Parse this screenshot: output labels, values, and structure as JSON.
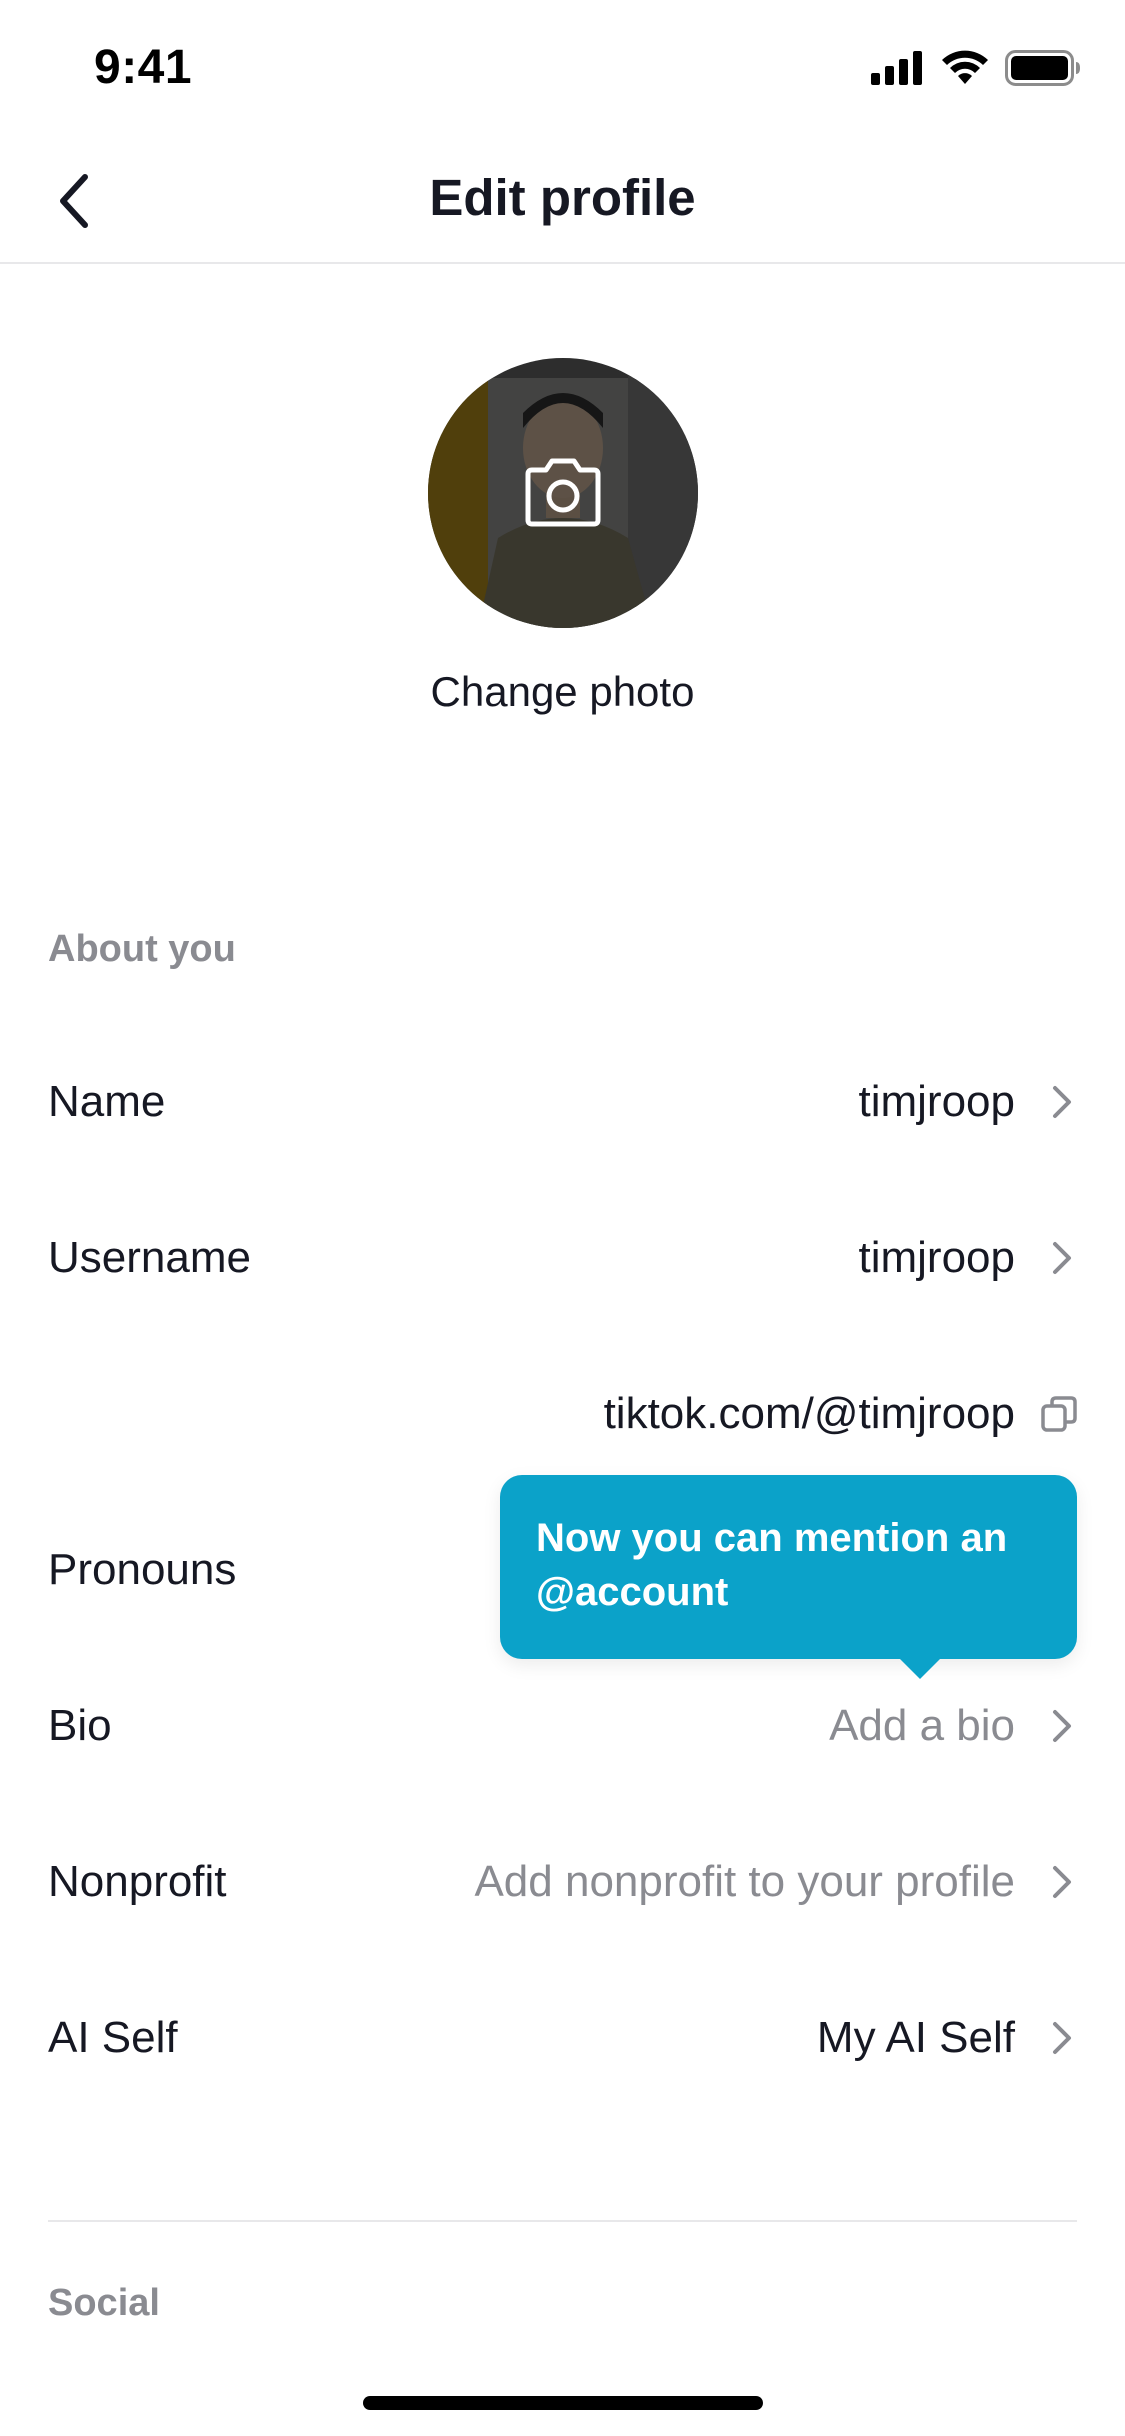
{
  "status_bar": {
    "time": "9:41"
  },
  "header": {
    "title": "Edit profile"
  },
  "avatar": {
    "change_photo_label": "Change photo"
  },
  "about_you": {
    "section_label": "About you",
    "rows": {
      "name": {
        "label": "Name",
        "value": "timjroop"
      },
      "username": {
        "label": "Username",
        "value": "timjroop"
      },
      "profile_url": "tiktok.com/@timjroop",
      "pronouns": {
        "label": "Pronouns",
        "value": ""
      },
      "bio": {
        "label": "Bio",
        "placeholder": "Add a bio"
      },
      "nonprofit": {
        "label": "Nonprofit",
        "placeholder": "Add nonprofit to your profile"
      },
      "ai_self": {
        "label": "AI Self",
        "value": "My AI Self"
      }
    }
  },
  "tooltip": {
    "text": "Now you can mention an @account"
  },
  "social": {
    "section_label": "Social"
  },
  "colors": {
    "accent": "#0ba2c9",
    "secondary_text": "#8a8b91",
    "primary_text": "#161823"
  }
}
